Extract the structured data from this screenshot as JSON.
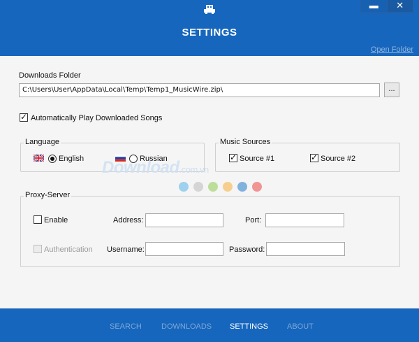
{
  "window": {
    "title": "SETTINGS",
    "minimize_glyph": "▬",
    "close_glyph": "✕",
    "app_icon": "app-logo-icon"
  },
  "header": {
    "open_folder": "Open Folder"
  },
  "downloads": {
    "label": "Downloads Folder",
    "path": "C:\\Users\\User\\AppData\\Local\\Temp\\Temp1_MusicWire.zip\\",
    "browse_label": "..."
  },
  "autoplay": {
    "label": "Automatically Play Downloaded Songs",
    "checked": true
  },
  "language": {
    "title": "Language",
    "options": [
      {
        "label": "English",
        "selected": true,
        "flag": "uk-flag-icon"
      },
      {
        "label": "Russian",
        "selected": false,
        "flag": "russia-flag-icon"
      }
    ]
  },
  "music_sources": {
    "title": "Music Sources",
    "items": [
      {
        "label": "Source #1",
        "checked": true
      },
      {
        "label": "Source #2",
        "checked": true
      }
    ]
  },
  "proxy": {
    "title": "Proxy-Server",
    "enable_label": "Enable",
    "enable_checked": false,
    "address_label": "Address:",
    "address_value": "",
    "port_label": "Port:",
    "port_value": "",
    "auth_label": "Authentication",
    "auth_checked": false,
    "username_label": "Username:",
    "username_value": "",
    "password_label": "Password:",
    "password_value": ""
  },
  "nav": {
    "items": [
      {
        "label": "SEARCH",
        "active": false
      },
      {
        "label": "DOWNLOADS",
        "active": false
      },
      {
        "label": "SETTINGS",
        "active": true
      },
      {
        "label": "ABOUT",
        "active": false
      }
    ]
  },
  "watermark": {
    "text": "Download",
    "suffix": ".com.vn",
    "dot_colors": [
      "#7fc4ea",
      "#c9c9c9",
      "#a9d67a",
      "#f5c26b",
      "#5a9bd6",
      "#ef7373"
    ]
  },
  "colors": {
    "accent": "#1666bd",
    "nav_inactive": "#7ea7d6",
    "link": "#8eb5de"
  }
}
